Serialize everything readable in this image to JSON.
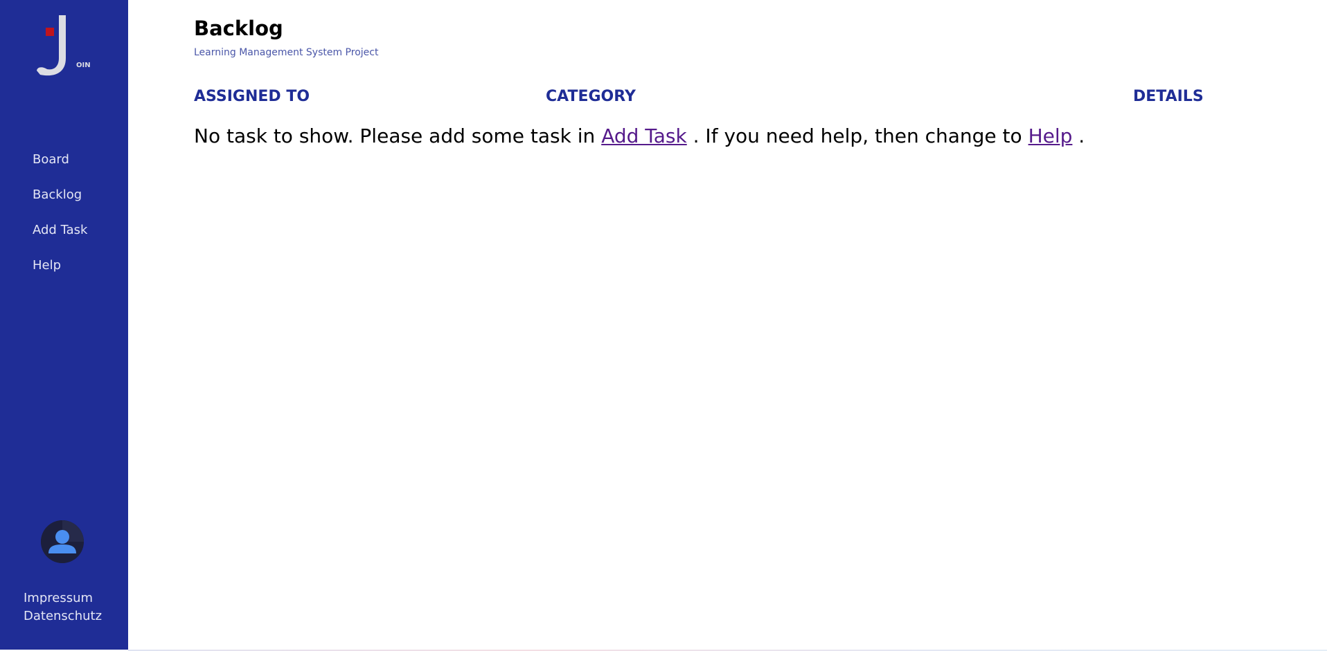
{
  "app": {
    "logo_text": "OIN"
  },
  "sidebar": {
    "items": [
      {
        "label": "Board"
      },
      {
        "label": "Backlog"
      },
      {
        "label": "Add Task"
      },
      {
        "label": "Help"
      }
    ],
    "legal": [
      {
        "label": "Impressum"
      },
      {
        "label": "Datenschutz"
      }
    ]
  },
  "header": {
    "title": "Backlog",
    "subtitle": "Learning Management System Project"
  },
  "table": {
    "columns": [
      "ASSIGNED TO",
      "CATEGORY",
      "DETAILS"
    ]
  },
  "empty_state": {
    "text_before": "No task to show. Please add some task in ",
    "link1": "Add Task",
    "text_middle": " . If you need help, then change to ",
    "link2": "Help",
    "text_after": " ."
  },
  "colors": {
    "sidebar_bg": "#1f2d96",
    "accent": "#1f2d96",
    "logo_red": "#c0141d",
    "link_visited": "#551a8b",
    "avatar_icon": "#4a8ef0"
  },
  "icons": {
    "logo": "join-logo",
    "avatar": "user-avatar-icon"
  }
}
